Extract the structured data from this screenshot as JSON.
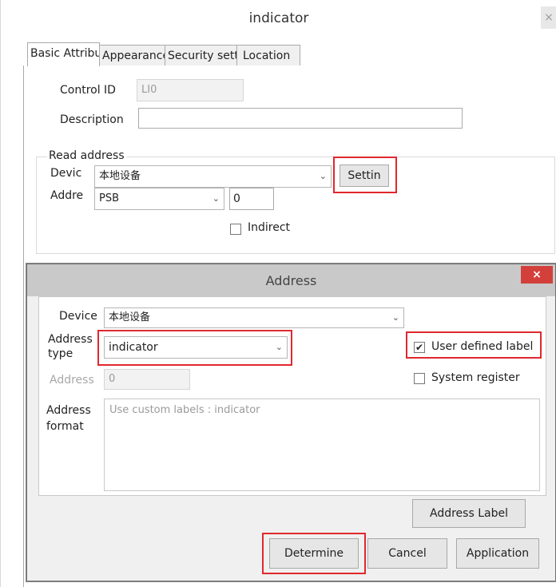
{
  "outer": {
    "title": "indicator",
    "close": "×",
    "tabs": [
      {
        "label": "Basic Attributes",
        "active": true
      },
      {
        "label": "Appearance",
        "active": false
      },
      {
        "label": "Security settings",
        "active": false
      },
      {
        "label": "Location",
        "active": false
      }
    ],
    "control_id_label": "Control ID",
    "control_id_value": "LI0",
    "description_label": "Description",
    "description_value": "",
    "read_address": {
      "group_label": "Read address",
      "device_label": "Devic",
      "device_value": "本地设备",
      "settings_button": "Settin",
      "address_label": "Addre",
      "address_type": "PSB",
      "address_value": "0",
      "indirect_label": "Indirect",
      "indirect_checked": false
    }
  },
  "dialog": {
    "title": "Address",
    "close": "×",
    "device_label": "Device",
    "device_value": "本地设备",
    "address_type_label_1": "Address",
    "address_type_label_2": "type",
    "address_type_value": "indicator",
    "user_defined_label": "User defined label",
    "user_defined_checked": true,
    "address_label": "Address",
    "address_value": "0",
    "system_register_label": "System register",
    "system_register_checked": false,
    "format_label_1": "Address",
    "format_label_2": "format",
    "format_value": "Use custom labels : indicator",
    "address_label_button": "Address Label",
    "determine_button": "Determine",
    "cancel_button": "Cancel",
    "application_button": "Application"
  },
  "colors": {
    "highlight": "#e0282e",
    "dialog_close": "#d3403b"
  },
  "icons": {
    "dropdown": "chevron-down-icon",
    "check": "check-icon",
    "close": "close-icon"
  }
}
